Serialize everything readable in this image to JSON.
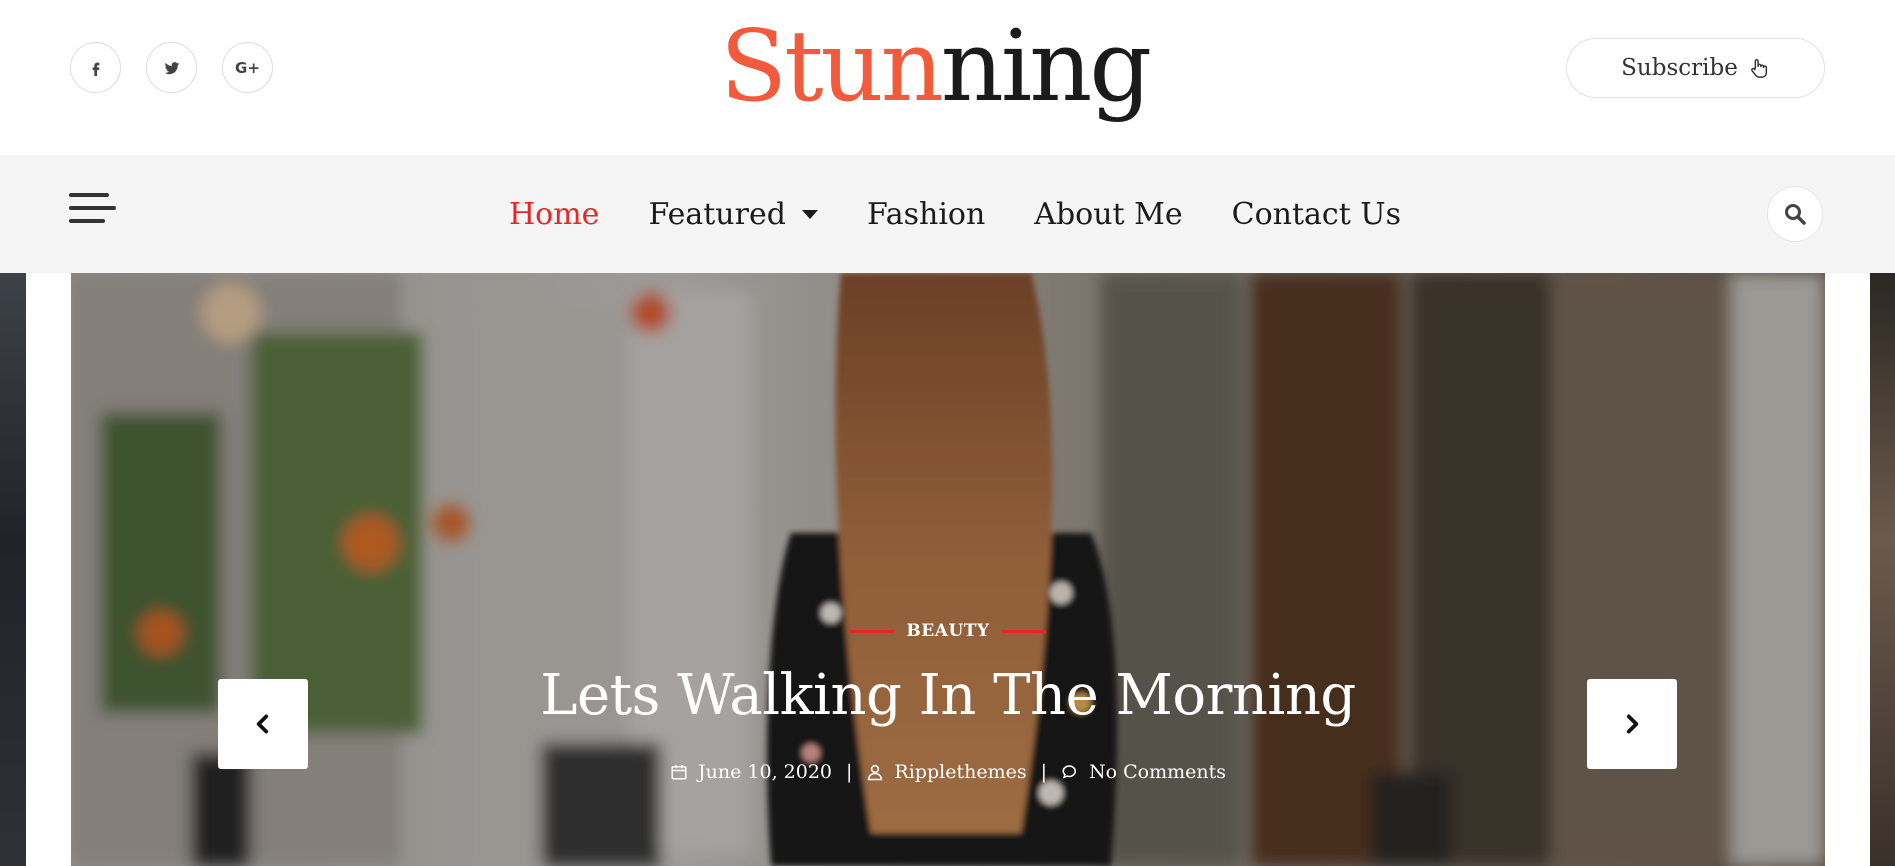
{
  "header": {
    "social": [
      {
        "name": "facebook",
        "icon": "facebook-icon"
      },
      {
        "name": "twitter",
        "icon": "twitter-icon"
      },
      {
        "name": "google-plus",
        "icon": "google-plus-icon",
        "glyph": "G+"
      }
    ],
    "logo": {
      "part1": "Stun",
      "part2": "ning",
      "color1": "#f25a3c",
      "color2": "#1b1b1b"
    },
    "subscribe_label": "Subscribe",
    "subscribe_icon": "pointer-hand-icon"
  },
  "nav": {
    "items": [
      {
        "label": "Home",
        "active": true
      },
      {
        "label": "Featured",
        "has_dropdown": true
      },
      {
        "label": "Fashion"
      },
      {
        "label": "About Me"
      },
      {
        "label": "Contact Us"
      }
    ],
    "active_color": "#e7262a",
    "hamburger_icon": "hamburger-menu-icon",
    "search_icon": "search-icon"
  },
  "slider": {
    "category": "BEAUTY",
    "title": "Lets Walking In The Morning",
    "date": "June 10, 2020",
    "author": "Ripplethemes",
    "comments": "No Comments",
    "separator": "|",
    "accent_color": "#e7262a",
    "prev_icon": "chevron-left-icon",
    "next_icon": "chevron-right-icon"
  }
}
